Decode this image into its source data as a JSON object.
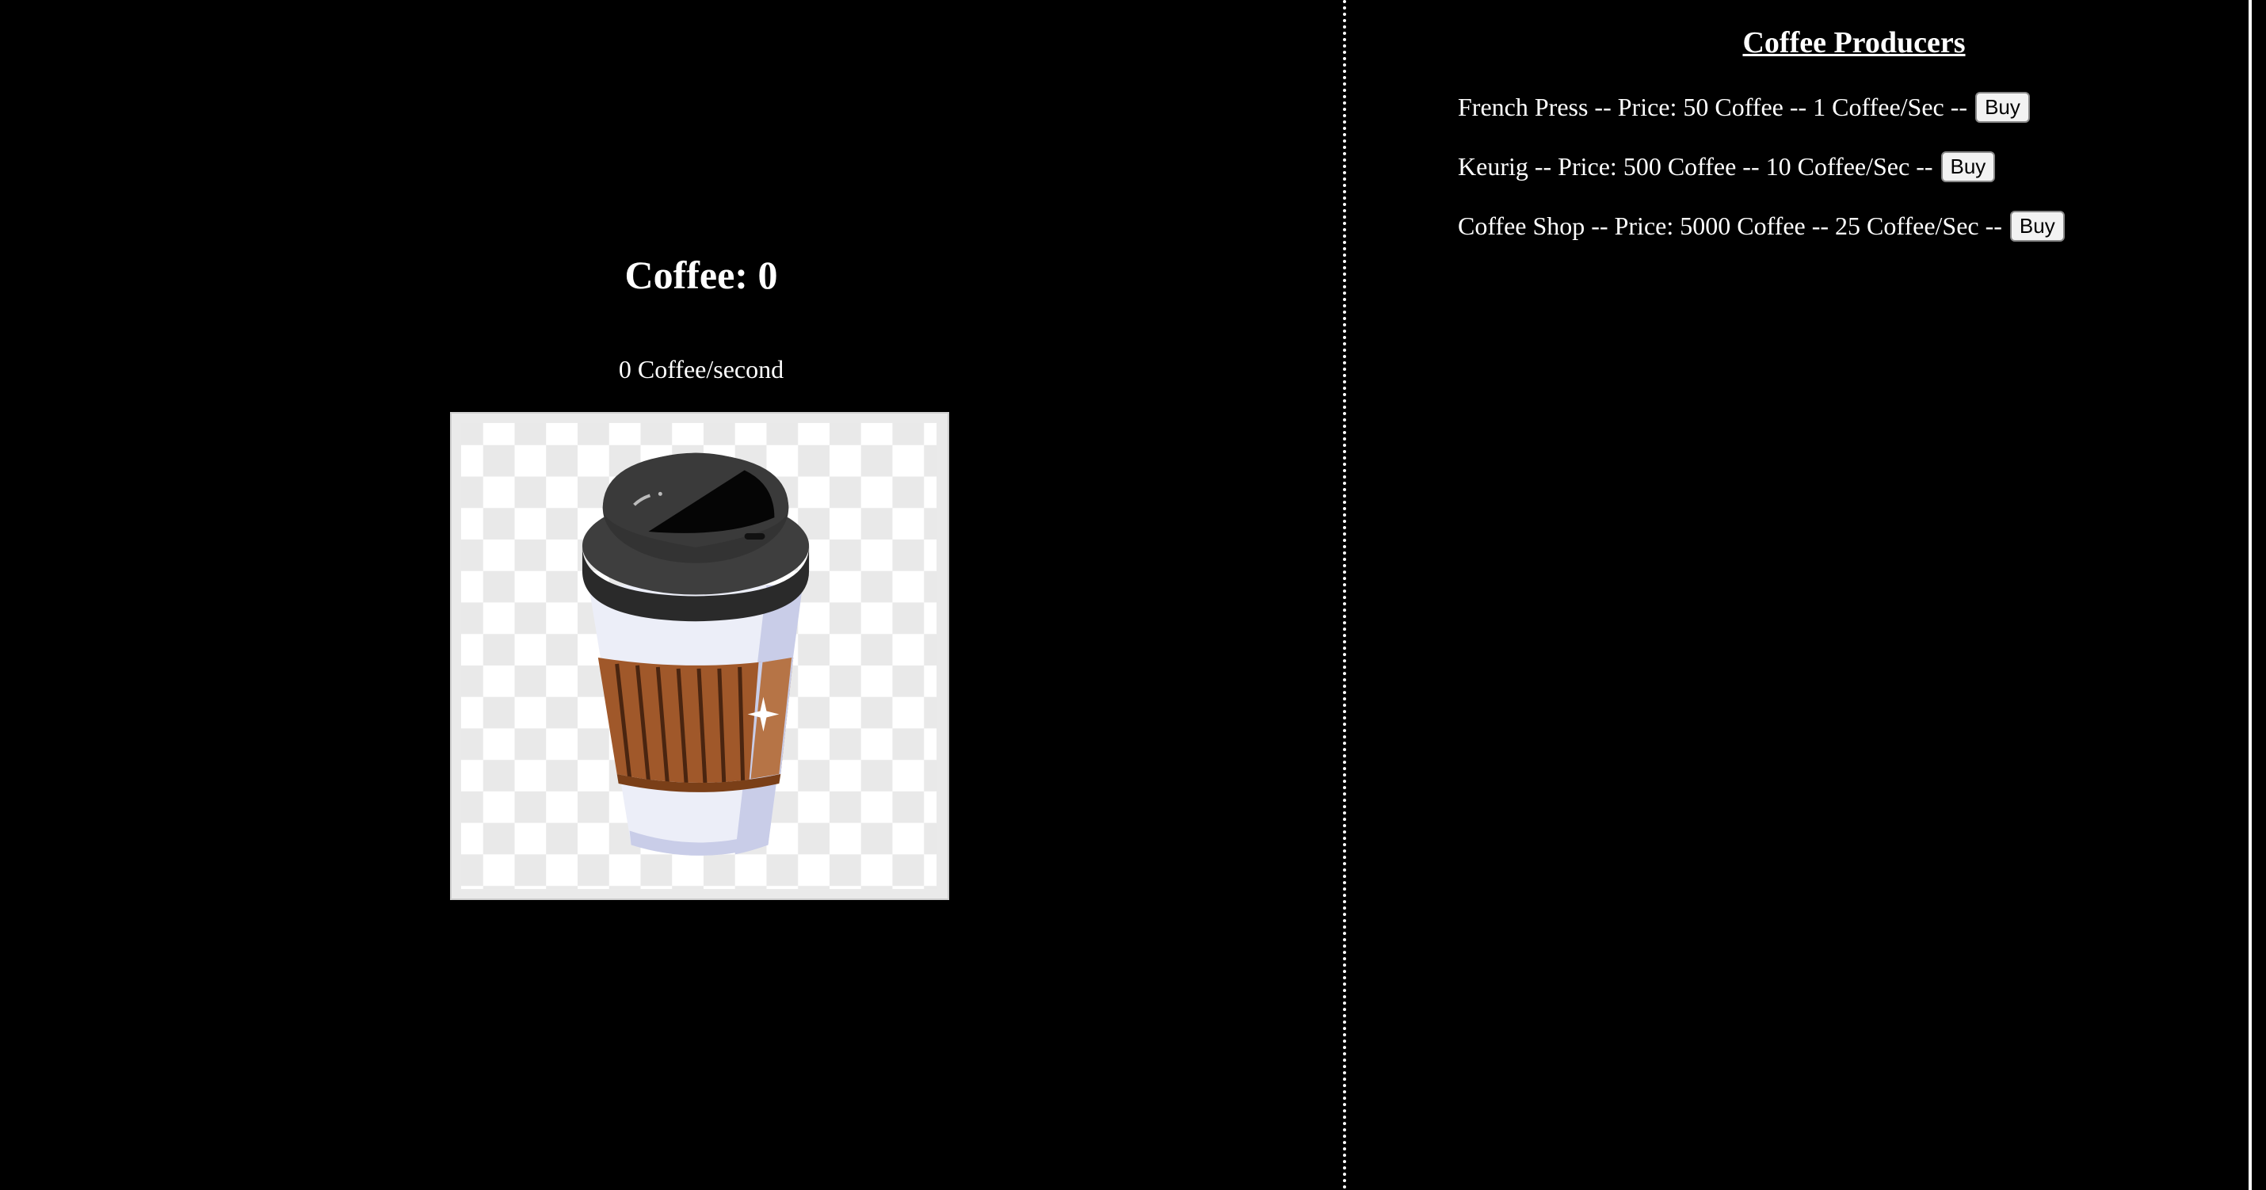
{
  "game": {
    "counter_label": "Coffee: 0",
    "rate_label": "0 Coffee/second"
  },
  "producers": {
    "title": "Coffee Producers",
    "items": [
      {
        "label": "French Press -- Price: 50 Coffee -- 1 Coffee/Sec --",
        "button": "Buy"
      },
      {
        "label": "Keurig -- Price: 500 Coffee -- 10 Coffee/Sec --",
        "button": "Buy"
      },
      {
        "label": "Coffee Shop -- Price: 5000 Coffee -- 25 Coffee/Sec --",
        "button": "Buy"
      }
    ]
  },
  "icons": {
    "cup": "coffee-cup-icon"
  },
  "colors": {
    "background": "#000000",
    "text": "#ffffff",
    "sleeve": "#a0582a",
    "lid": "#3a3a3a"
  }
}
